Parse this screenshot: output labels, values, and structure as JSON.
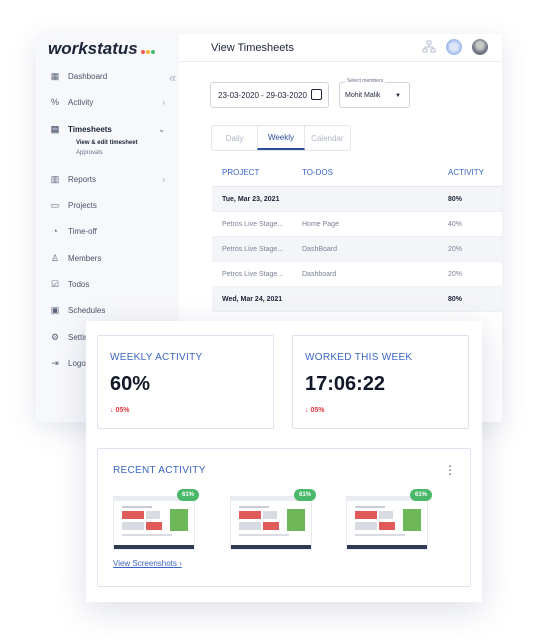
{
  "app": {
    "logo": "workstatus",
    "logo_dot_colors": [
      "#f25c54",
      "#f7b538",
      "#49b869"
    ],
    "page_title": "View Timesheets",
    "collapse_glyph": "«"
  },
  "sidebar": {
    "items": [
      {
        "label": "Dashboard",
        "icon": "grid-icon",
        "glyph": "▦",
        "chevron": ""
      },
      {
        "label": "Activity",
        "icon": "percent-icon",
        "glyph": "%",
        "chevron": "›"
      },
      {
        "label": "Timesheets",
        "icon": "timesheet-icon",
        "glyph": "▤",
        "chevron": "⌄"
      },
      {
        "label": "Reports",
        "icon": "report-icon",
        "glyph": "▥",
        "chevron": "›"
      },
      {
        "label": "Projects",
        "icon": "folder-icon",
        "glyph": "▭",
        "chevron": ""
      },
      {
        "label": "Time-off",
        "icon": "clock-icon",
        "glyph": "◔",
        "chevron": ""
      },
      {
        "label": "Members",
        "icon": "person-icon",
        "glyph": "♙",
        "chevron": ""
      },
      {
        "label": "Todos",
        "icon": "todo-icon",
        "glyph": "☑",
        "chevron": ""
      },
      {
        "label": "Schedules",
        "icon": "calendar-icon",
        "glyph": "▣",
        "chevron": ""
      },
      {
        "label": "Settings",
        "icon": "gear-icon",
        "glyph": "⚙",
        "chevron": ""
      },
      {
        "label": "Logout",
        "icon": "logout-icon",
        "glyph": "⇥",
        "chevron": ""
      }
    ],
    "sub_items": [
      "View & edit timesheet",
      "Approvals"
    ]
  },
  "filters": {
    "date_range": "23-03-2020 - 29-03-2020",
    "member_label": "Select members",
    "member_value": "Mohit Malik"
  },
  "tabs": [
    "Daily",
    "Weekly",
    "Calendar"
  ],
  "active_tab": "Weekly",
  "table": {
    "headers": [
      "PROJECT",
      "TO-DOS",
      "ACTIVITY"
    ],
    "rows": [
      {
        "type": "date",
        "project": "Tue, Mar 23, 2021",
        "todo": "",
        "activity": "80%"
      },
      {
        "type": "row",
        "project": "Petros Live Stage...",
        "todo": "Home Page",
        "activity": "40%"
      },
      {
        "type": "row",
        "project": "Petros Live Stage...",
        "todo": "DashBoard",
        "activity": "20%"
      },
      {
        "type": "row",
        "project": "Petros Live Stage...",
        "todo": "Dashboard",
        "activity": "20%"
      },
      {
        "type": "date",
        "project": "Wed, Mar 24, 2021",
        "todo": "",
        "activity": "80%"
      }
    ]
  },
  "weekly_activity": {
    "title": "WEEKLY ACTIVITY",
    "value": "60%",
    "change": "05%",
    "arrow": "↓"
  },
  "worked_this_week": {
    "title": "WORKED THIS WEEK",
    "value": "17:06:22",
    "change": "05%",
    "arrow": "↓"
  },
  "recent_activity": {
    "title": "RECENT ACTIVITY",
    "menu_glyph": "⋮",
    "screenshots": [
      {
        "percent": "61%"
      },
      {
        "percent": "61%"
      },
      {
        "percent": "61%"
      }
    ],
    "link": "View Screenshots",
    "link_glyph": "›"
  },
  "colors": {
    "accent": "#3b65c4",
    "danger": "#e0383e",
    "success": "#49b869"
  }
}
